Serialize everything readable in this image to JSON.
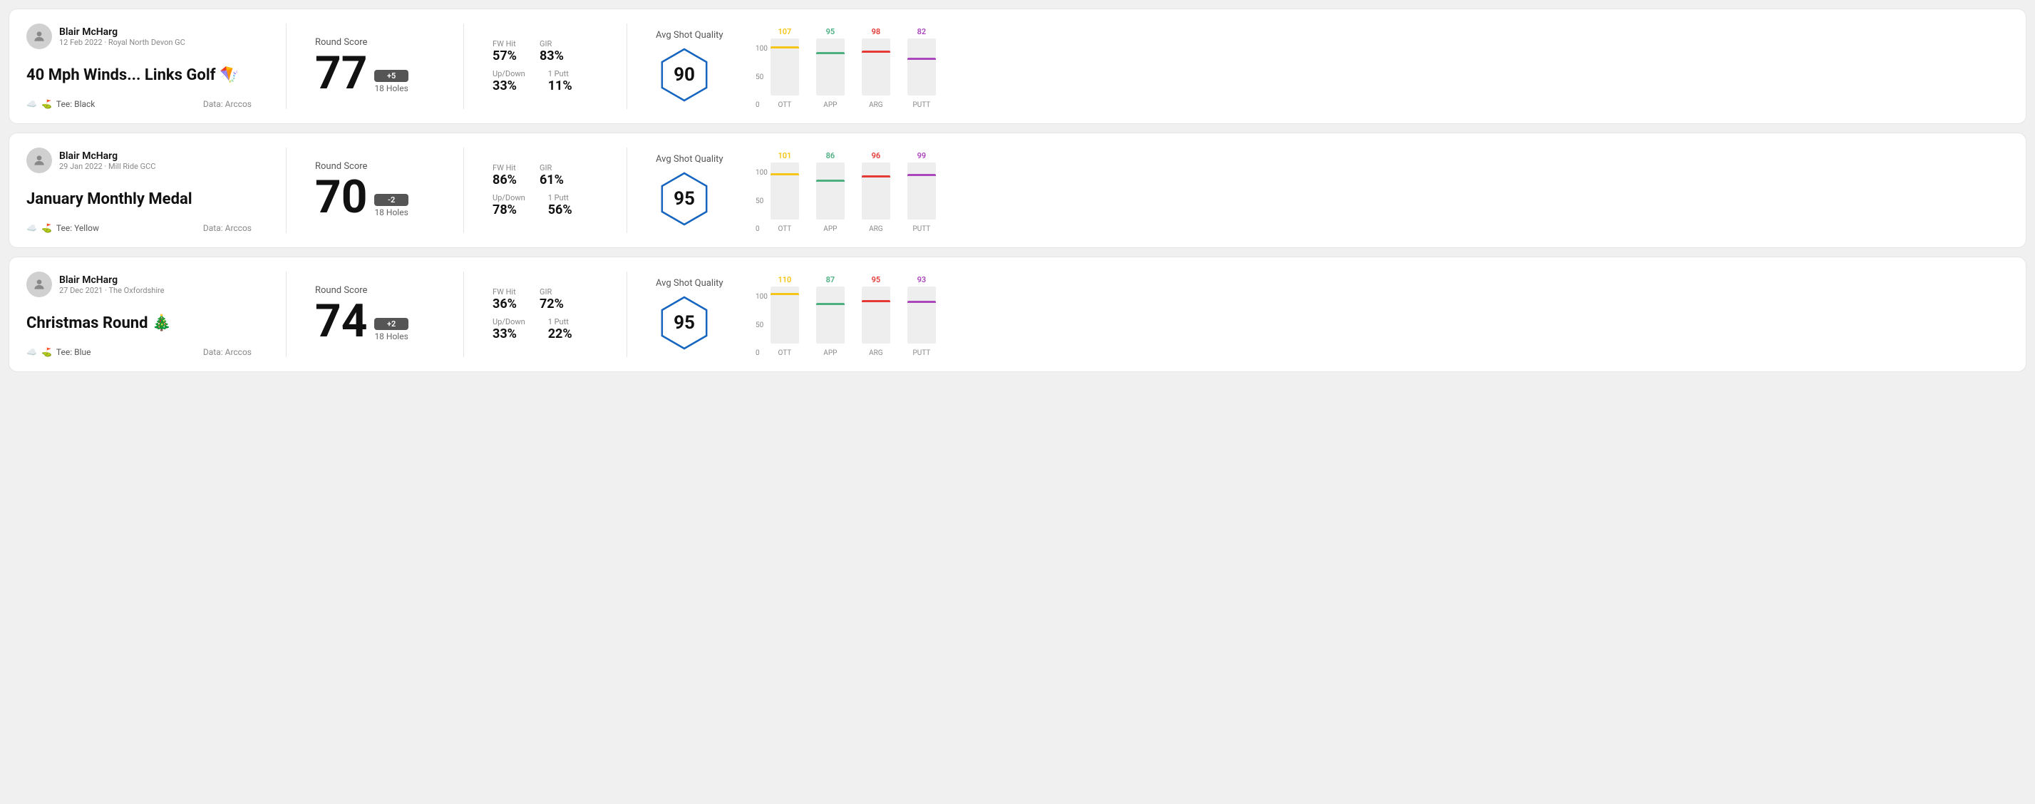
{
  "rounds": [
    {
      "id": "round-1",
      "user": {
        "name": "Blair McHarg",
        "meta": "12 Feb 2022 · Royal North Devon GC"
      },
      "title": "40 Mph Winds... Links Golf 🪁",
      "tee": "Black",
      "data_source": "Data: Arccos",
      "score": {
        "label": "Round Score",
        "number": "77",
        "badge": "+5",
        "holes": "18 Holes"
      },
      "stats": {
        "fw_hit_label": "FW Hit",
        "fw_hit_value": "57%",
        "gir_label": "GIR",
        "gir_value": "83%",
        "updown_label": "Up/Down",
        "updown_value": "33%",
        "oneputt_label": "1 Putt",
        "oneputt_value": "11%"
      },
      "quality": {
        "label": "Avg Shot Quality",
        "score": "90"
      },
      "chart": {
        "bars": [
          {
            "label": "OTT",
            "value": 107,
            "color": "#f5c518",
            "max": 130
          },
          {
            "label": "APP",
            "value": 95,
            "color": "#4caf80",
            "max": 130
          },
          {
            "label": "ARG",
            "value": 98,
            "color": "#e53935",
            "max": 130
          },
          {
            "label": "PUTT",
            "value": 82,
            "color": "#ab47bc",
            "max": 130
          }
        ]
      }
    },
    {
      "id": "round-2",
      "user": {
        "name": "Blair McHarg",
        "meta": "29 Jan 2022 · Mill Ride GCC"
      },
      "title": "January Monthly Medal",
      "tee": "Yellow",
      "data_source": "Data: Arccos",
      "score": {
        "label": "Round Score",
        "number": "70",
        "badge": "-2",
        "holes": "18 Holes"
      },
      "stats": {
        "fw_hit_label": "FW Hit",
        "fw_hit_value": "86%",
        "gir_label": "GIR",
        "gir_value": "61%",
        "updown_label": "Up/Down",
        "updown_value": "78%",
        "oneputt_label": "1 Putt",
        "oneputt_value": "56%"
      },
      "quality": {
        "label": "Avg Shot Quality",
        "score": "95"
      },
      "chart": {
        "bars": [
          {
            "label": "OTT",
            "value": 101,
            "color": "#f5c518",
            "max": 130
          },
          {
            "label": "APP",
            "value": 86,
            "color": "#4caf80",
            "max": 130
          },
          {
            "label": "ARG",
            "value": 96,
            "color": "#e53935",
            "max": 130
          },
          {
            "label": "PUTT",
            "value": 99,
            "color": "#ab47bc",
            "max": 130
          }
        ]
      }
    },
    {
      "id": "round-3",
      "user": {
        "name": "Blair McHarg",
        "meta": "27 Dec 2021 · The Oxfordshire"
      },
      "title": "Christmas Round 🎄",
      "tee": "Blue",
      "data_source": "Data: Arccos",
      "score": {
        "label": "Round Score",
        "number": "74",
        "badge": "+2",
        "holes": "18 Holes"
      },
      "stats": {
        "fw_hit_label": "FW Hit",
        "fw_hit_value": "36%",
        "gir_label": "GIR",
        "gir_value": "72%",
        "updown_label": "Up/Down",
        "updown_value": "33%",
        "oneputt_label": "1 Putt",
        "oneputt_value": "22%"
      },
      "quality": {
        "label": "Avg Shot Quality",
        "score": "95"
      },
      "chart": {
        "bars": [
          {
            "label": "OTT",
            "value": 110,
            "color": "#f5c518",
            "max": 130
          },
          {
            "label": "APP",
            "value": 87,
            "color": "#4caf80",
            "max": 130
          },
          {
            "label": "ARG",
            "value": 95,
            "color": "#e53935",
            "max": 130
          },
          {
            "label": "PUTT",
            "value": 93,
            "color": "#ab47bc",
            "max": 130
          }
        ]
      }
    }
  ],
  "chart_y_labels": [
    "100",
    "50",
    "0"
  ]
}
